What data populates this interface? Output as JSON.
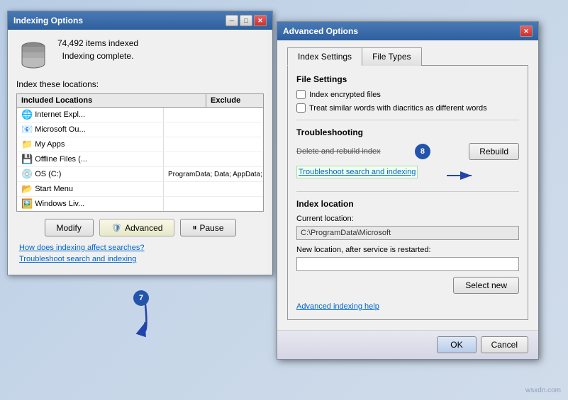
{
  "background": {
    "color": "#c5d5e8"
  },
  "indexing_window": {
    "title": "Indexing Options",
    "items_count": "74,492 items indexed",
    "status": "Indexing complete.",
    "locations_label": "Index these locations:",
    "columns": {
      "included": "Included Locations",
      "exclude": "Exclude"
    },
    "locations": [
      {
        "icon": "🌐",
        "name": "Internet Expl...",
        "exclude": ""
      },
      {
        "icon": "📧",
        "name": "Microsoft Ou...",
        "exclude": ""
      },
      {
        "icon": "📁",
        "name": "My Apps",
        "exclude": ""
      },
      {
        "icon": "💾",
        "name": "Offline Files (...",
        "exclude": ""
      },
      {
        "icon": "💿",
        "name": "OS (C:)",
        "exclude": "ProgramData; Data; AppData; AppData; ..."
      },
      {
        "icon": "📂",
        "name": "Start Menu",
        "exclude": ""
      },
      {
        "icon": "🖼️",
        "name": "Windows Liv...",
        "exclude": ""
      }
    ],
    "buttons": {
      "modify": "Modify",
      "advanced": "Advanced",
      "pause": "Pause"
    },
    "links": {
      "how_indexing": "How does indexing affect searches?",
      "troubleshoot": "Troubleshoot search and indexing"
    }
  },
  "advanced_window": {
    "title": "Advanced Options",
    "tabs": [
      {
        "label": "Index Settings",
        "active": true
      },
      {
        "label": "File Types",
        "active": false
      }
    ],
    "file_settings": {
      "title": "File Settings",
      "options": [
        {
          "label": "Index encrypted files",
          "checked": false
        },
        {
          "label": "Treat similar words with diacritics as different words",
          "checked": false
        }
      ]
    },
    "troubleshooting": {
      "title": "Troubleshooting",
      "delete_rebuild_label": "Delete and rebuild index",
      "rebuild_button": "Rebuild",
      "troubleshoot_link": "Troubleshoot search and indexing"
    },
    "index_location": {
      "title": "Index location",
      "current_label": "Current location:",
      "current_value": "C:\\ProgramData\\Microsoft",
      "new_label": "New location, after service is restarted:",
      "new_value": "",
      "select_new_button": "Select new"
    },
    "advanced_link": "Advanced indexing help",
    "ok_button": "OK",
    "cancel_button": "Cancel"
  },
  "step_numbers": {
    "step7": "7",
    "step8": "8"
  }
}
